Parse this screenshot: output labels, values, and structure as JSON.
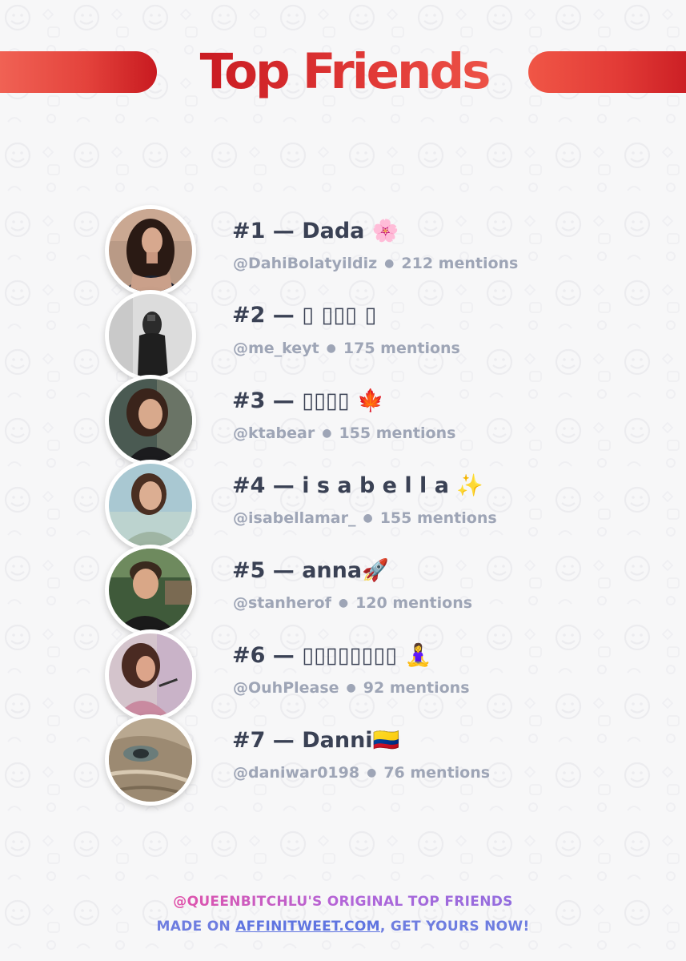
{
  "header": {
    "title": "Top Friends"
  },
  "friends": [
    {
      "rank_label": "#1 — Dada 🌸",
      "handle": "@DahiBolatyildiz",
      "mentions": "212 mentions"
    },
    {
      "rank_label": "#2 — ▯ ▯▯▯ ▯",
      "handle": "@me_keyt",
      "mentions": "175 mentions"
    },
    {
      "rank_label": "#3 — ▯▯▯▯ 🍁",
      "handle": "@ktabear",
      "mentions": "155 mentions"
    },
    {
      "rank_label": "#4 — i s a b e l l a ✨",
      "handle": "@isabellamar_",
      "mentions": "155 mentions"
    },
    {
      "rank_label": "#5 — anna🚀",
      "handle": "@stanherof",
      "mentions": "120 mentions"
    },
    {
      "rank_label": "#6 — ▯▯▯▯▯▯▯▯ 🧘‍♀️",
      "handle": "@OuhPlease",
      "mentions": "92 mentions"
    },
    {
      "rank_label": "#7 — Danni🇨🇴",
      "handle": "@daniwar0198",
      "mentions": "76 mentions"
    }
  ],
  "footer": {
    "line1": "@QUEENBITCHLU'S ORIGINAL TOP FRIENDS",
    "line2_prefix": "MADE ON ",
    "line2_link": "AFFINITWEET.COM",
    "line2_suffix": ", GET YOURS NOW!"
  },
  "colors": {
    "title_red": "#d4242b",
    "name_text": "#3a4154",
    "sub_text": "#9ea5b6",
    "footer_pink": "#ea4fa0",
    "footer_blue": "#6e7de0"
  }
}
